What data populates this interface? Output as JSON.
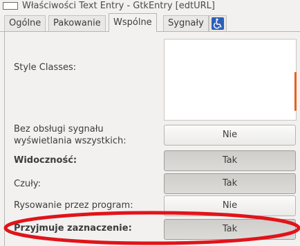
{
  "window": {
    "title": "Właściwości Text Entry - GtkEntry [edtURL]"
  },
  "tabs": [
    {
      "label": "Ogólne",
      "active": false
    },
    {
      "label": "Pakowanie",
      "active": false
    },
    {
      "label": "Wspólne",
      "active": true
    },
    {
      "label": "Sygnały",
      "active": false
    },
    {
      "label": "",
      "icon": "accessibility-icon",
      "active": false
    }
  ],
  "properties": {
    "style_classes": {
      "label": "Style Classes:"
    },
    "no_show_all": {
      "label_line1": "Bez obsługi sygnału",
      "label_line2": "wyświetlania wszystkich:",
      "value": "Nie",
      "pressed": false
    },
    "visible": {
      "label": "Widoczność:",
      "value": "Tak",
      "pressed": true
    },
    "sensitive": {
      "label": "Czuły:",
      "value": "Tak",
      "pressed": true
    },
    "app_paintable": {
      "label": "Rysowanie przez program:",
      "value": "Nie",
      "pressed": false
    },
    "can_default": {
      "label": "Przyjmuje zaznaczenie:",
      "value": "Tak",
      "pressed": true
    }
  },
  "colors": {
    "annotation": "#e0141a",
    "scrollbar": "#e8601c",
    "accessibility": "#2c5fb8"
  }
}
